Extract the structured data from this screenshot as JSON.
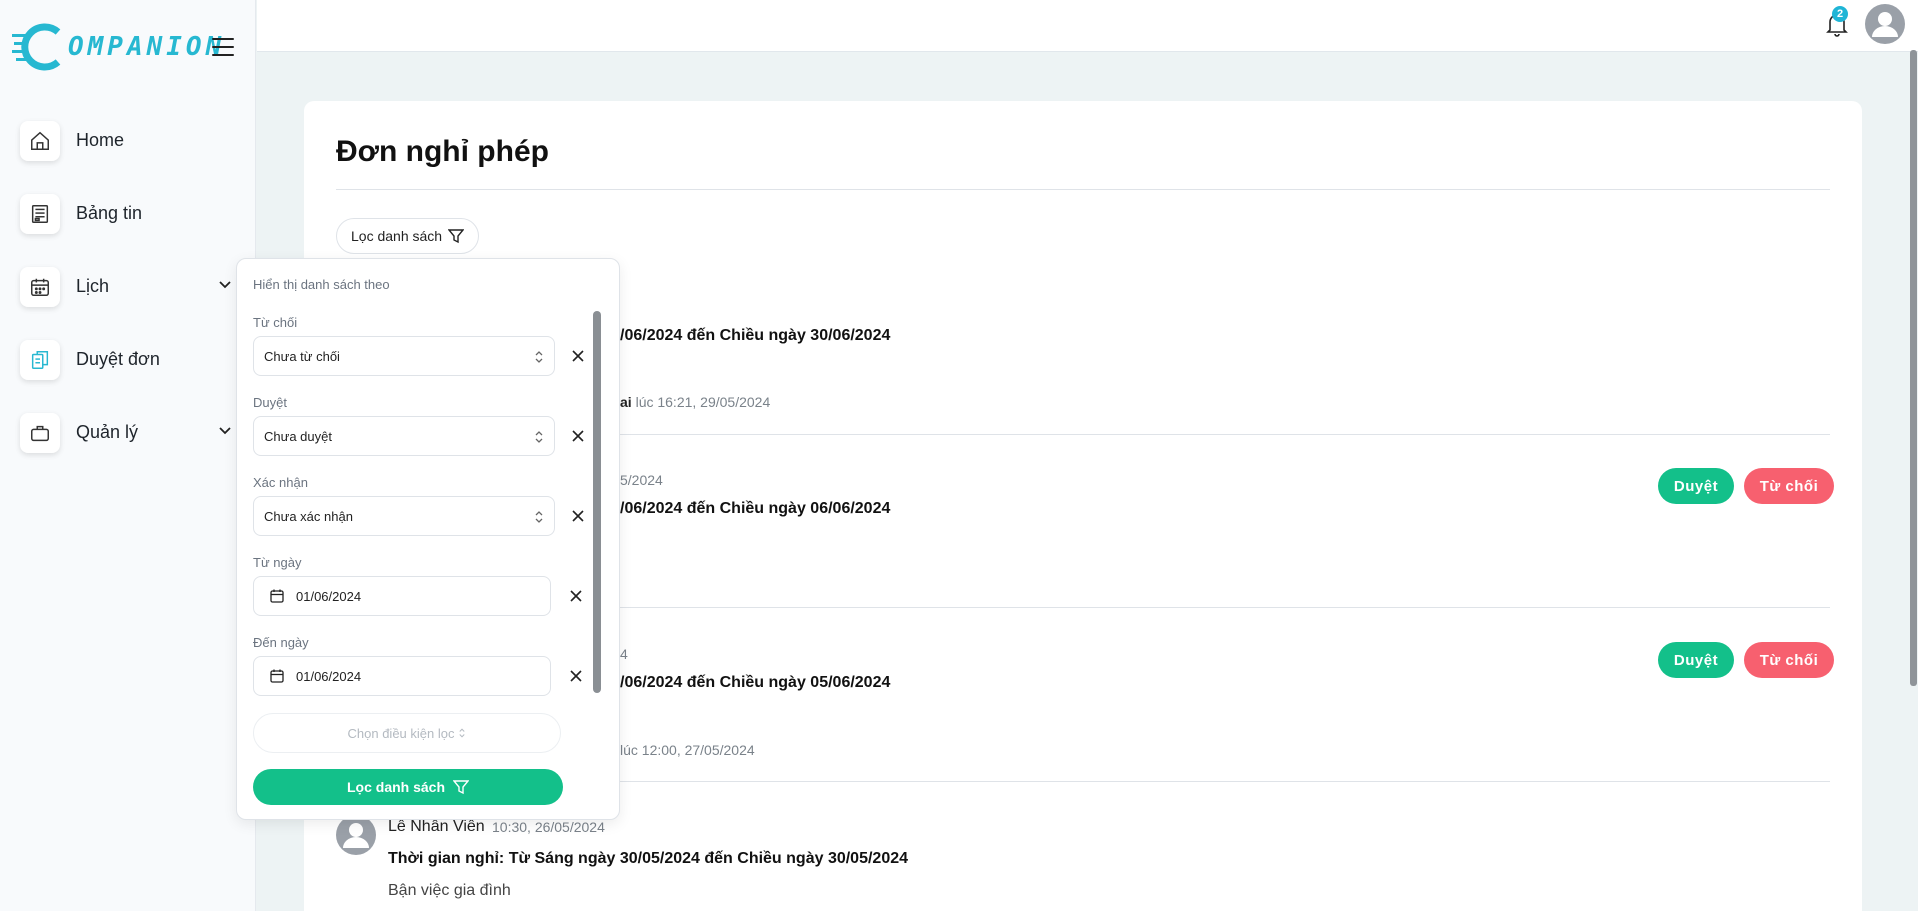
{
  "brand": {
    "name": "OMPANION",
    "accent": "#27b8d1"
  },
  "sidebar": {
    "items": [
      {
        "label": "Home",
        "icon": "home-icon",
        "has_chevron": false
      },
      {
        "label": "Bảng tin",
        "icon": "newspaper-icon",
        "has_chevron": false
      },
      {
        "label": "Lịch",
        "icon": "calendar-icon",
        "has_chevron": true
      },
      {
        "label": "Duyệt đơn",
        "icon": "documents-icon",
        "has_chevron": false
      },
      {
        "label": "Quản lý",
        "icon": "briefcase-icon",
        "has_chevron": true
      }
    ]
  },
  "topbar": {
    "notification_count": "2"
  },
  "page": {
    "title": "Đơn nghỉ phép",
    "filter_button": "Lọc danh sách"
  },
  "requests": [
    {
      "time_text": "/06/2024 đến Chiều ngày 30/06/2024",
      "sub_name": "ai",
      "sub_time": "lúc 16:21, 29/05/2024"
    },
    {
      "date_text": "5/2024",
      "time_text": "/06/2024 đến Chiều ngày 06/06/2024",
      "approve": "Duyệt",
      "reject": "Từ chối"
    },
    {
      "date_text": "4",
      "time_text": "/06/2024 đến Chiều ngày 05/06/2024",
      "sub_time": "lúc 12:00, 27/05/2024",
      "approve": "Duyệt",
      "reject": "Từ chối"
    },
    {
      "name": "Lê Nhân Viên",
      "date_text": "10:30, 26/05/2024",
      "time_text": "Thời gian nghỉ: Từ Sáng ngày 30/05/2024 đến Chiều ngày 30/05/2024",
      "reason": "Bận việc gia đình"
    }
  ],
  "filter_popover": {
    "heading": "Hiển thị danh sách theo",
    "fields": [
      {
        "label": "Từ chối",
        "value": "Chưa từ chối"
      },
      {
        "label": "Duyệt",
        "value": "Chưa duyệt"
      },
      {
        "label": "Xác nhận",
        "value": "Chưa xác nhận"
      },
      {
        "label": "Từ ngày",
        "value": "01/06/2024"
      },
      {
        "label": "Đến ngày",
        "value": "01/06/2024"
      }
    ],
    "condition_placeholder": "Chọn điều kiện lọc",
    "submit": "Lọc danh sách"
  },
  "colors": {
    "approve": "#13c08a",
    "reject": "#f7606f"
  }
}
